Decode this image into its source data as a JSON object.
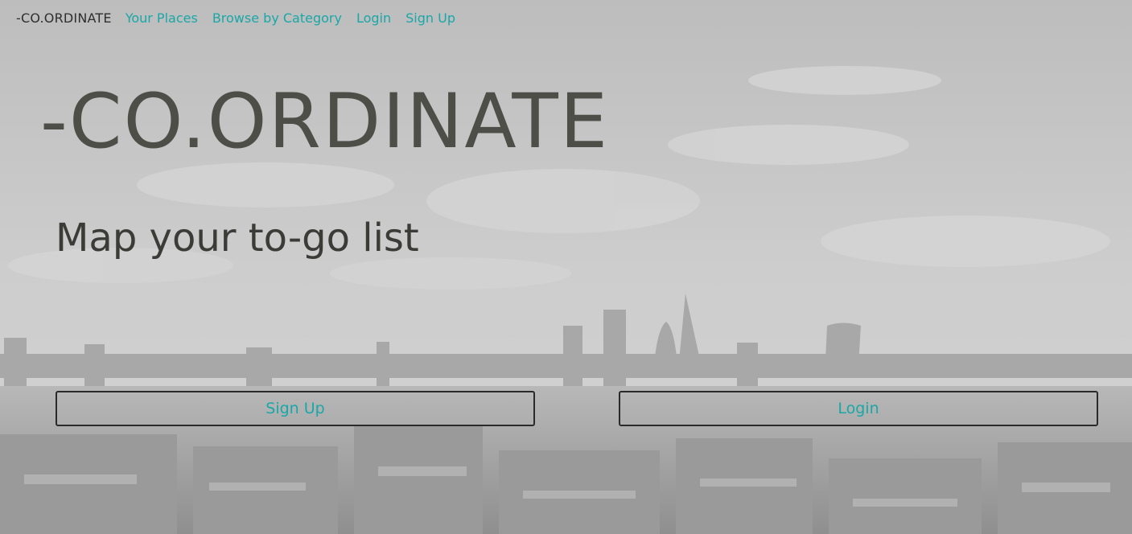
{
  "nav": {
    "brand": "-CO.ORDINATE",
    "links": [
      {
        "label": "Your Places"
      },
      {
        "label": "Browse by Category"
      },
      {
        "label": "Login"
      },
      {
        "label": "Sign Up"
      }
    ]
  },
  "hero": {
    "title": "-CO.ORDINATE",
    "subtitle": "Map your to-go list"
  },
  "cta": {
    "signup_label": "Sign Up",
    "login_label": "Login"
  },
  "colors": {
    "link": "#1aa7a7",
    "title": "#4e4e48",
    "background": "#c4c4c4"
  },
  "background_image": "city-skyline-grayscale"
}
